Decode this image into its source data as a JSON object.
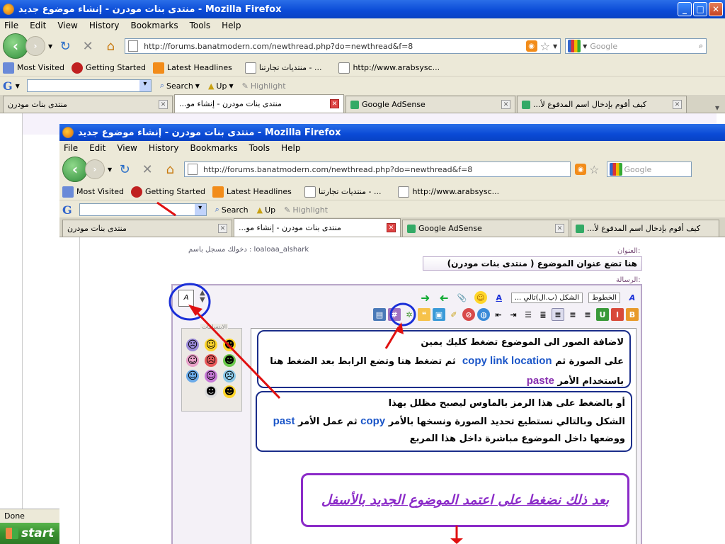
{
  "outer": {
    "window_title": "منتدى بنات مودرن - إنشاء موضوع جديد - Mozilla Firefox",
    "menu": [
      "File",
      "Edit",
      "View",
      "History",
      "Bookmarks",
      "Tools",
      "Help"
    ],
    "url": "http://forums.banatmodern.com/newthread.php?do=newthread&f=8",
    "search_placeholder": "Google",
    "bookmarks": [
      "Most Visited",
      "Getting Started",
      "Latest Headlines",
      "منتديات تجارتنا - ...",
      "http://www.arabsysc..."
    ],
    "gbar": {
      "logo": "G",
      "search": "Search",
      "up": "Up",
      "highlight": "Highlight"
    },
    "tabs": [
      "منتدى بنات مودرن",
      "منتدى بنات مودرن - إنشاء مو...",
      "Google AdSense",
      "كيف أقوم بإدخال اسم المدفوع لأ..."
    ],
    "status": "Done",
    "start": "start"
  },
  "inner": {
    "window_title": "منتدى بنات مودرن - إنشاء موضوع جديد - Mozilla Firefox",
    "menu": [
      "File",
      "Edit",
      "View",
      "History",
      "Bookmarks",
      "Tools",
      "Help"
    ],
    "url": "http://forums.banatmodern.com/newthread.php?do=newthread&f=8",
    "search_placeholder": "Google",
    "bookmarks": [
      "Most Visited",
      "Getting Started",
      "Latest Headlines",
      "منتديات تجارتنا - ...",
      "http://www.arabsysc..."
    ],
    "gbar": {
      "logo": "G",
      "search": "Search",
      "up": "Up",
      "highlight": "Highlight"
    },
    "tabs": [
      "منتدى بنات مودرن",
      "منتدى بنات مودرن - إنشاء مو...",
      "Google AdSense",
      "كيف أقوم بإدخال اسم المدفوع لأ..."
    ]
  },
  "form": {
    "logged_in": "دخولك مسجل باسم : loaloaa_alshark",
    "title_label": "العنوان:",
    "title_value": "هنا تضع عنوان الموضوع ( منتدى بنات مودرن)",
    "message_label": "الرسالة:",
    "font_label": "الخطوط",
    "size_label": "الشكل (ب.ال)تالي ...",
    "smilies_caption": "الابتسامات"
  },
  "notes": {
    "n1_line1": "لاضافة الصور الى الموضوع تضغط كليك يمين",
    "n1_line2a": "على الصورة ثم",
    "n1_copy": "copy link location",
    "n1_line2b": "ثم تضغط هنا وتضع الرابط بعد الضغط هنا",
    "n1_line3": "باستخدام الأمر",
    "n1_paste": "paste",
    "n2_line1": "أو بالضغط على هذا الرمز بالماوس ليصبح مظلل بهذا",
    "n2_line2a": "الشكل وبالتالي نستطيع تحديد الصورة ونسخها بالأمر",
    "n2_copy": "copy",
    "n2_line2b": "ثم عمل الأمر",
    "n2_past": "past",
    "n2_line3": "ووضعها داخل الموضوع مباشرة داخل هذا المربع",
    "n3": "بعد ذلك نضغط على اعتمد الموضوع الجديد بالأسفل"
  },
  "colors": {
    "annotation_red": "#e01010",
    "annotation_blue": "#1a2fd8",
    "note_purple": "#8b2bc8"
  }
}
